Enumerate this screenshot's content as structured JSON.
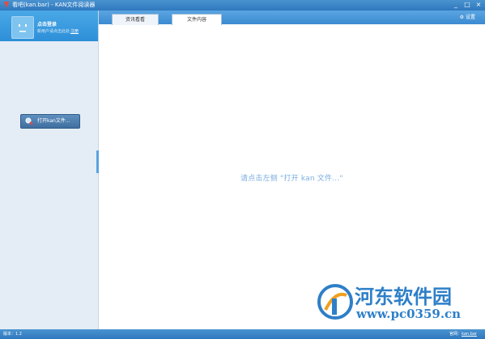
{
  "window": {
    "title": "看吧(kan.bar) - KAN文件阅读器",
    "minimize": "_",
    "maximize": "□",
    "close": "×"
  },
  "sidebar": {
    "login_title": "点击登录",
    "login_sub": "新用户请点击此处",
    "register": "注册",
    "open_button": "打开kan文件..."
  },
  "tabs": [
    {
      "label": "资讯看看"
    },
    {
      "label": "文件内容"
    }
  ],
  "toolbar": {
    "settings": "设置"
  },
  "main": {
    "hint": "请点击左侧 \"打开 kan 文件...\""
  },
  "watermark": {
    "name": "河东软件园",
    "url": "www.pc0359.cn"
  },
  "status": {
    "version": "版本：1.2",
    "homepage_label": "官网：",
    "homepage_link": "kan.bar"
  },
  "colors": {
    "accent": "#3b8ad1",
    "hint": "#7aaee0"
  }
}
